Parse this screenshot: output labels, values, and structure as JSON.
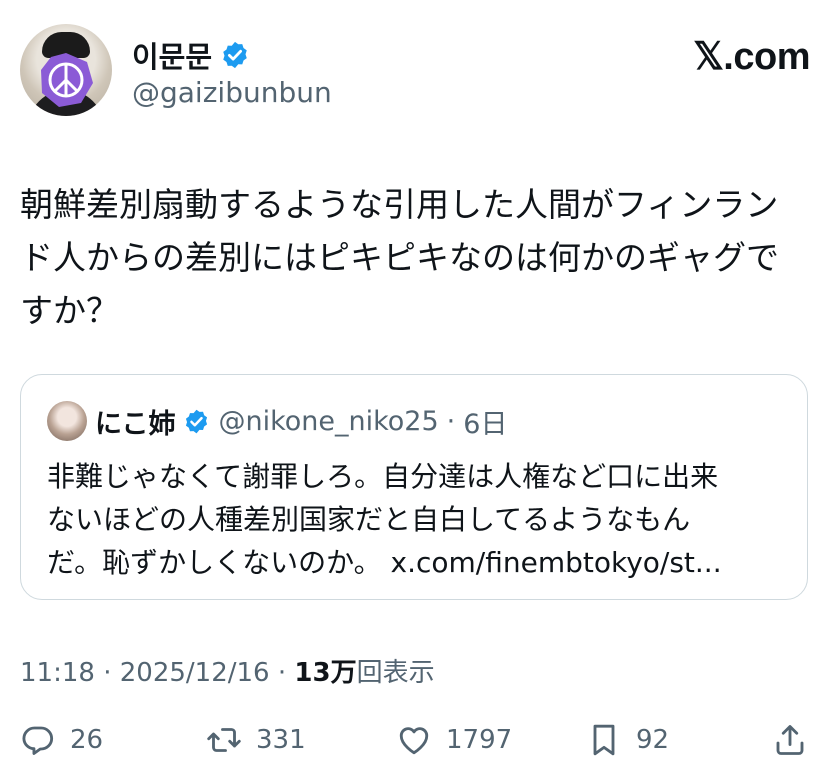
{
  "author": {
    "display_name": "이문문",
    "handle": "@gaizibunbun",
    "verified": true
  },
  "brand": "𝕏.com",
  "tweet": {
    "text": "朝鮮差別扇動するような引用した人間がフィンラン\nド人からの差別にはピキピキなのは何かのギャグで\nすか？"
  },
  "quoted": {
    "display_name": "にこ姉",
    "verified": true,
    "handle": "@nikone_niko25",
    "separator": "·",
    "time": "6日",
    "text": "非難じゃなくて謝罪しろ。自分達は人権など口に出来\nないほどの人種差別国家だと自白してるようなもん\nだ。恥ずかしくないのか。 x.com/finembtokyo/st..."
  },
  "meta": {
    "time": "11:18",
    "separator": "·",
    "date": "2025/12/16",
    "views_count": "13万",
    "views_label": "回表示"
  },
  "actions": {
    "replies": "26",
    "retweets": "331",
    "likes": "1797",
    "bookmarks": "92"
  },
  "colors": {
    "verified": "#1d9bf0",
    "muted": "#536471",
    "border": "#cfd9de"
  }
}
